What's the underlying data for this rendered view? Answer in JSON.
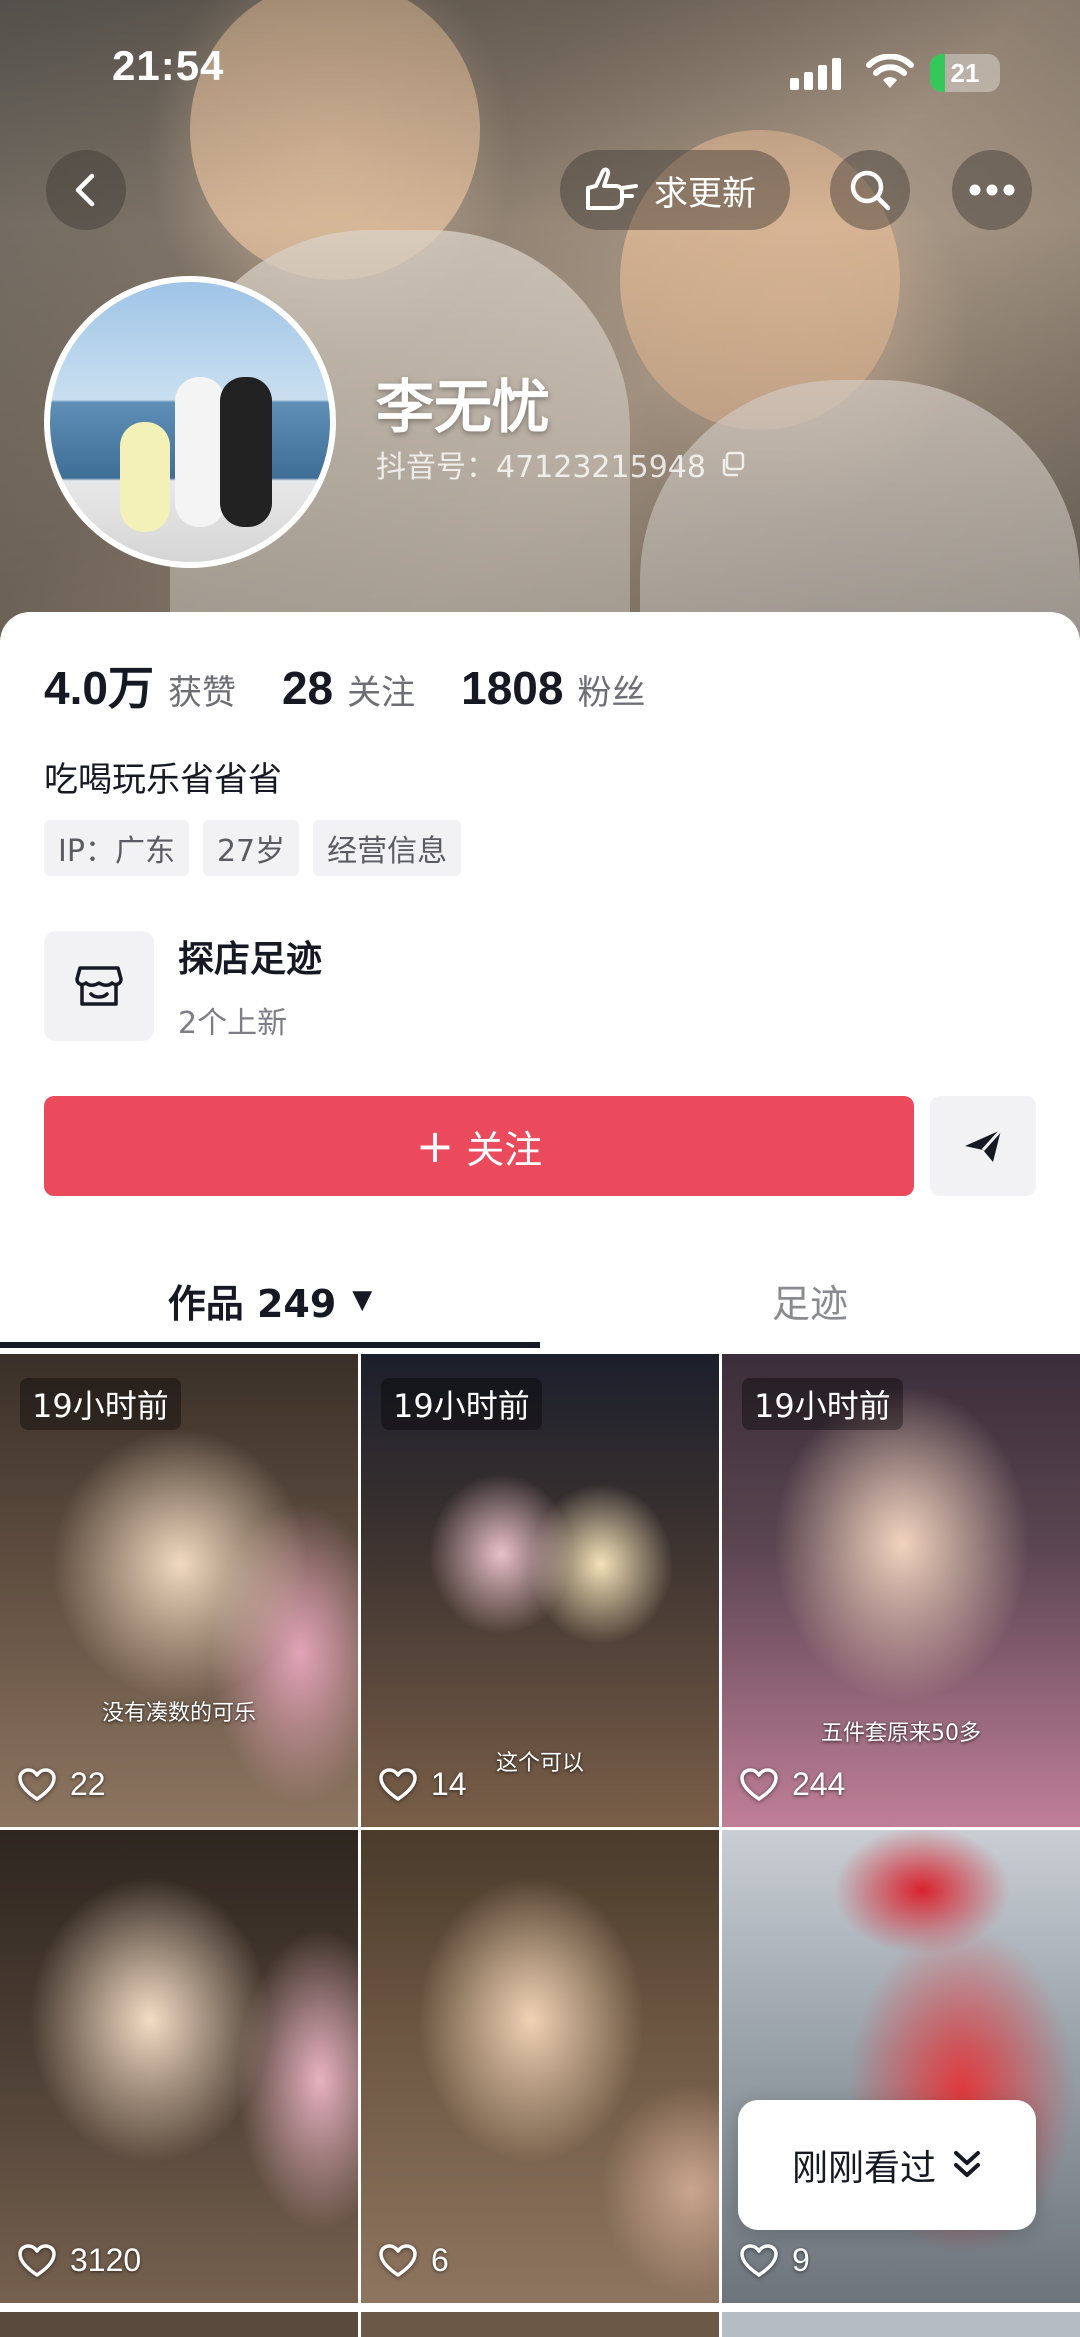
{
  "status_bar": {
    "time": "21:54",
    "battery": "21",
    "battery_level": 0.21
  },
  "header": {
    "request_update_label": "求更新"
  },
  "profile": {
    "name": "李无忧",
    "douyin_id": "抖音号：47123215948",
    "stats": [
      {
        "value": "4.0万",
        "label": "获赞"
      },
      {
        "value": "28",
        "label": "关注"
      },
      {
        "value": "1808",
        "label": "粉丝"
      }
    ],
    "bio": "吃喝玩乐省省省",
    "tags": [
      "IP：广东",
      "27岁",
      "经营信息"
    ]
  },
  "shop": {
    "title": "探店足迹",
    "subtitle": "2个上新"
  },
  "actions": {
    "follow_label": "关注"
  },
  "tabs": {
    "works_label": "作品 249",
    "footprint_label": "足迹"
  },
  "videos": [
    {
      "pinned": "19小时前",
      "caption": "没有凑数的可乐",
      "likes": "22"
    },
    {
      "pinned": "19小时前",
      "caption": "这个可以",
      "likes": "14"
    },
    {
      "pinned": "19小时前",
      "caption": "五件套原来50多",
      "likes": "244"
    },
    {
      "pinned": "",
      "caption": "",
      "likes": "3120"
    },
    {
      "pinned": "",
      "caption": "",
      "likes": "6"
    },
    {
      "pinned": "",
      "caption": "",
      "likes": "9"
    }
  ],
  "recently_viewed": {
    "label": "刚刚看过"
  },
  "colors": {
    "accent": "#ea4a5c",
    "text_primary": "#161823",
    "text_secondary": "#6e6f76",
    "tag_bg": "#f2f2f4"
  }
}
